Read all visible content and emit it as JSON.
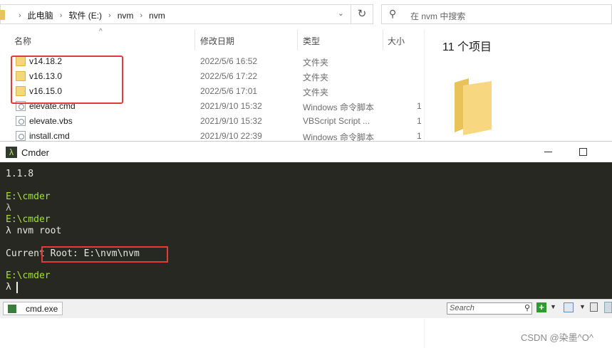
{
  "explorer": {
    "breadcrumb": [
      "此电脑",
      "软件 (E:)",
      "nvm",
      "nvm"
    ],
    "search_placeholder": "在 nvm 中搜索",
    "columns": {
      "name": "名称",
      "date": "修改日期",
      "type": "类型",
      "size": "大小"
    },
    "files": [
      {
        "name": "v14.18.2",
        "date": "2022/5/6 16:52",
        "type": "文件夹",
        "size": "",
        "kind": "folder"
      },
      {
        "name": "v16.13.0",
        "date": "2022/5/6 17:22",
        "type": "文件夹",
        "size": "",
        "kind": "folder"
      },
      {
        "name": "v16.15.0",
        "date": "2022/5/6 17:01",
        "type": "文件夹",
        "size": "",
        "kind": "folder"
      },
      {
        "name": "elevate.cmd",
        "date": "2021/9/10 15:32",
        "type": "Windows 命令脚本",
        "size": "1",
        "kind": "file"
      },
      {
        "name": "elevate.vbs",
        "date": "2021/9/10 15:32",
        "type": "VBScript Script ...",
        "size": "1",
        "kind": "file"
      },
      {
        "name": "install.cmd",
        "date": "2021/9/10 22:39",
        "type": "Windows 命令脚本",
        "size": "1",
        "kind": "file"
      }
    ],
    "item_count": "11 个项目"
  },
  "cmder": {
    "title": "Cmder",
    "lines": [
      {
        "text": "1.1.8",
        "color": "white"
      },
      {
        "text": "",
        "color": "white"
      },
      {
        "text": "E:\\cmder",
        "color": "green"
      },
      {
        "text": "λ",
        "color": "grey"
      },
      {
        "text": "E:\\cmder",
        "color": "green"
      },
      {
        "text": "λ nvm root",
        "color": "white"
      },
      {
        "text": "",
        "color": "white"
      },
      {
        "text": "Current Root: E:\\nvm\\nvm",
        "color": "white"
      },
      {
        "text": "",
        "color": "white"
      },
      {
        "text": "E:\\cmder",
        "color": "green"
      },
      {
        "text": "λ",
        "color": "white"
      }
    ],
    "tab_label": "cmd.exe",
    "search_placeholder": "Search"
  },
  "watermark": "CSDN @染墨^O^",
  "colors": {
    "highlight": "#e23b3b",
    "terminal_bg": "#272822",
    "prompt": "#a6e22e"
  }
}
